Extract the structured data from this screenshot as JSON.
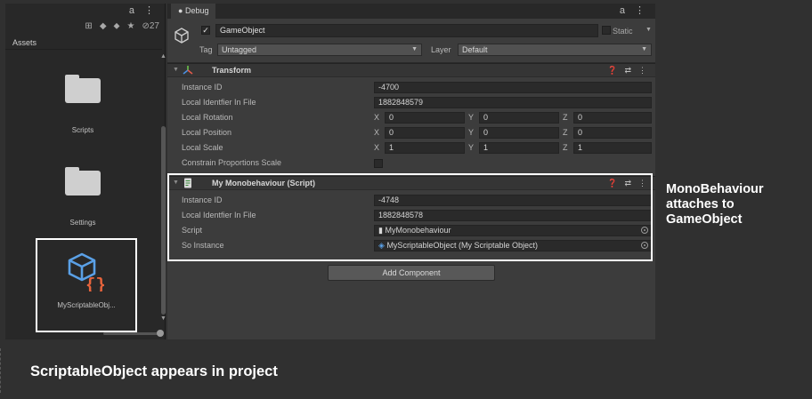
{
  "project": {
    "title_icons": "a ⋮",
    "toolbar": {
      "eye_count": "27"
    },
    "assets_label": "Assets",
    "items": [
      {
        "label": "Scripts",
        "icon": "folder-icon"
      },
      {
        "label": "Settings",
        "icon": "folder-icon"
      },
      {
        "label": "MyScriptableObj...",
        "icon": "scriptable-object-icon"
      }
    ]
  },
  "inspector": {
    "tab_label": "Debug",
    "title_icons": "a ⋮",
    "gameobject": {
      "active_check": "✓",
      "name": "GameObject",
      "static_label": "Static",
      "tag_label": "Tag",
      "tag_value": "Untagged",
      "layer_label": "Layer",
      "layer_value": "Default"
    },
    "transform": {
      "title": "Transform",
      "rows": {
        "instance_id": {
          "label": "Instance ID",
          "value": "-4700"
        },
        "local_id": {
          "label": "Local Identfier In File",
          "value": "1882848579"
        },
        "rotation": {
          "label": "Local Rotation",
          "x": "0",
          "y": "0",
          "z": "0"
        },
        "position": {
          "label": "Local Position",
          "x": "0",
          "y": "0",
          "z": "0"
        },
        "scale": {
          "label": "Local Scale",
          "x": "1",
          "y": "1",
          "z": "1"
        },
        "constrain": {
          "label": "Constrain Proportions Scale"
        }
      }
    },
    "monobehaviour": {
      "title": "My Monobehaviour (Script)",
      "rows": {
        "instance_id": {
          "label": "Instance ID",
          "value": "-4748"
        },
        "local_id": {
          "label": "Local Identfier In File",
          "value": "1882848578"
        },
        "script": {
          "label": "Script",
          "value": "MyMonobehaviour"
        },
        "so_instance": {
          "label": "So Instance",
          "value": "MyScriptableObject (My Scriptable Object)"
        }
      }
    },
    "add_component": "Add Component",
    "axes": {
      "x": "X",
      "y": "Y",
      "z": "Z"
    }
  },
  "captions": {
    "right": "MonoBehaviour attaches to GameObject",
    "bottom": "ScriptableObject appears in project"
  },
  "colors": {
    "background": "#303030",
    "inspector": "#3c3c3c",
    "highlight": "#ffffff",
    "so_icon_blue": "#5aa0e6",
    "so_icon_orange": "#e8643c"
  }
}
